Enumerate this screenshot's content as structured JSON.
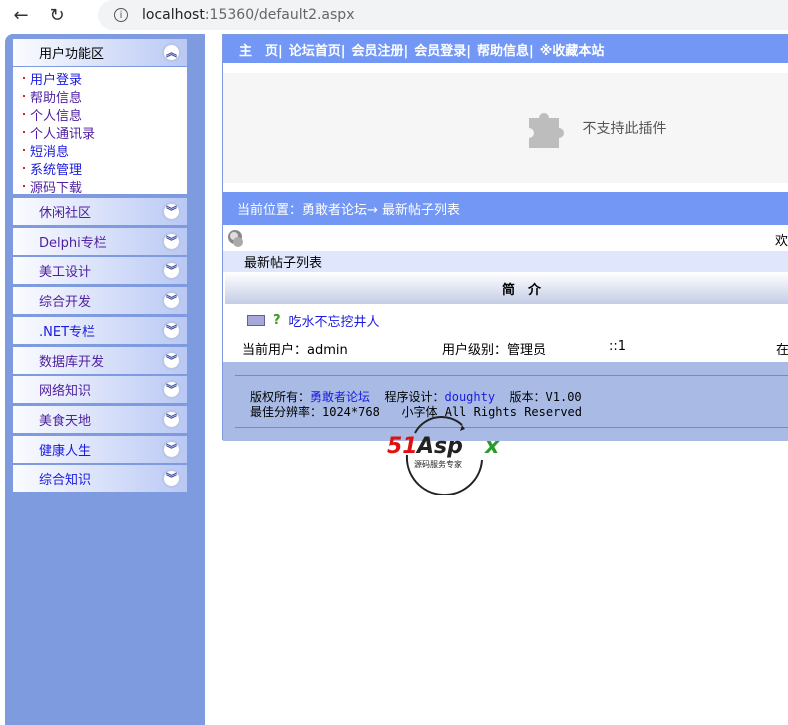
{
  "browser": {
    "url_host": "localhost",
    "url_rest": ":15360/default2.aspx"
  },
  "sidebar": {
    "open_panel": {
      "title": "用户功能区",
      "items": [
        {
          "label": "用户登录",
          "visited": false
        },
        {
          "label": "帮助信息",
          "visited": true
        },
        {
          "label": "个人信息",
          "visited": true
        },
        {
          "label": "个人通讯录",
          "visited": true
        },
        {
          "label": "短消息",
          "visited": false
        },
        {
          "label": "系统管理",
          "visited": false
        },
        {
          "label": "源码下载",
          "visited": true
        }
      ]
    },
    "panels": [
      {
        "label": "休闲社区",
        "visited": true
      },
      {
        "label": "Delphi专栏",
        "visited": true
      },
      {
        "label": "美工设计",
        "visited": true
      },
      {
        "label": "综合开发",
        "visited": true
      },
      {
        "label": ".NET专栏",
        "visited": false
      },
      {
        "label": "数据库开发",
        "visited": true
      },
      {
        "label": "网络知识",
        "visited": true
      },
      {
        "label": "美食天地",
        "visited": true
      },
      {
        "label": "健康人生",
        "visited": false
      },
      {
        "label": "综合知识",
        "visited": false
      }
    ]
  },
  "topnav": [
    "主　页|",
    "论坛首页|",
    "会员注册|",
    "会员登录|",
    "帮助信息|",
    "※收藏本站"
  ],
  "plugin_text": "不支持此插件",
  "breadcrumb": "当前位置：勇敢者论坛→ 最新帖子列表",
  "welcome": "欢",
  "list_title": "最新帖子列表",
  "table_header": "简　介",
  "post": {
    "title": "吃水不忘挖井人",
    "icon": "?"
  },
  "status": {
    "user": "当前用户：admin",
    "level": "用户级别：管理员",
    "colon": "::1",
    "online": "在"
  },
  "footer": {
    "copyright_label": "版权所有：",
    "copyright_link": "勇敢者论坛",
    "design_label": "程序设计：",
    "design_link": "doughty",
    "version": "版本：V1.00",
    "resolution": "最佳分辨率：1024*768",
    "font": "小字体 All Rights Reserved"
  },
  "watermark": {
    "brand": "51Aspx",
    "tagline": "源码服务专家"
  }
}
